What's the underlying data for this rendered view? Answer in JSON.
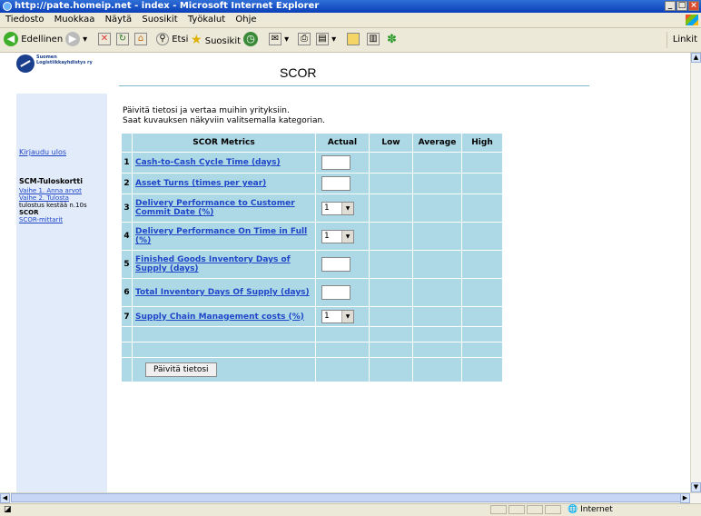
{
  "window": {
    "title": "http://pate.homeip.net - index - Microsoft Internet Explorer"
  },
  "menu": [
    "Tiedosto",
    "Muokkaa",
    "Näytä",
    "Suosikit",
    "Työkalut",
    "Ohje"
  ],
  "toolbar": {
    "back": "Edellinen",
    "search": "Etsi",
    "favorites": "Suosikit",
    "links": "Linkit"
  },
  "logo": {
    "text": "Suomen Logistiikkayhdistys ry"
  },
  "page": {
    "title": "SCOR",
    "intro1": "Päivitä tietosi ja vertaa muihin yrityksiin.",
    "intro2": "Saat kuvauksen näkyviin valitsemalla kategorian."
  },
  "sidebar": {
    "logout": "Kirjaudu ulos",
    "section_title": "SCM-Tuloskortti",
    "link1": "Vaihe 1. Anna arvot",
    "link2": "Vaihe 2. Tulosta",
    "plain": "tulostus kestää n.10s",
    "current": "SCOR",
    "link3": "SCOR-mittarit"
  },
  "table": {
    "headers": {
      "metric": "SCOR Metrics",
      "actual": "Actual",
      "low": "Low",
      "average": "Average",
      "high": "High"
    },
    "rows": [
      {
        "num": "1",
        "metric": "Cash-to-Cash Cycle Time (days)"
      },
      {
        "num": "2",
        "metric": "Asset Turns (times per year)"
      },
      {
        "num": "3",
        "metric": "Delivery Performance to Customer Commit Date (%)",
        "select": "1"
      },
      {
        "num": "4",
        "metric": "Delivery Performance On Time in Full (%)",
        "select": "1"
      },
      {
        "num": "5",
        "metric": "Finished Goods Inventory Days of Supply (days)"
      },
      {
        "num": "6",
        "metric": "Total Inventory Days Of Supply (days)"
      },
      {
        "num": "7",
        "metric": "Supply Chain Management costs (%)",
        "select": "1"
      }
    ],
    "button": "Päivitä tietosi"
  },
  "status": {
    "zone": "Internet"
  }
}
